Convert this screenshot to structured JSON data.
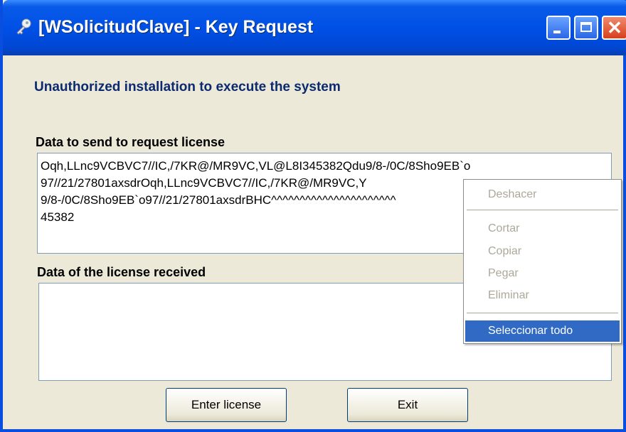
{
  "window": {
    "title": "[WSolicitudClave] - Key Request"
  },
  "titlebar_buttons": {
    "minimize_icon": "minimize-icon",
    "maximize_icon": "maximize-icon",
    "close_icon": "close-icon",
    "close_glyph": "✕"
  },
  "heading": "Unauthorized installation to execute the system",
  "send_section": {
    "label": "Data to send to request license",
    "value": "Oqh,LLnc9VCBVC7//IC,/7KR@/MR9VC,VL@L8I345382Qdu9/8-/0C/8Sho9EB`o\n97//21/27801axsdrOqh,LLnc9VCBVC7//IC,/7KR@/MR9VC,Y\n9/8-/0C/8Sho9EB`o97//21/27801axsdrBHC^^^^^^^^^^^^^^^^^^^^^^\n45382"
  },
  "receive_section": {
    "label": "Data of the license received",
    "value": ""
  },
  "buttons": {
    "enter_license": "Enter license",
    "exit": "Exit"
  },
  "context_menu": {
    "items": [
      {
        "label": "Deshacer",
        "enabled": false
      },
      {
        "label": "Cortar",
        "enabled": false
      },
      {
        "label": "Copiar",
        "enabled": false
      },
      {
        "label": "Pegar",
        "enabled": false
      },
      {
        "label": "Eliminar",
        "enabled": false
      },
      {
        "label": "Seleccionar todo",
        "enabled": true,
        "highlighted": true
      }
    ]
  },
  "colors": {
    "titlebar": "#0050e6",
    "heading": "#0b2a6f",
    "menu_highlight": "#316ac5",
    "disabled_text": "#aca899"
  }
}
